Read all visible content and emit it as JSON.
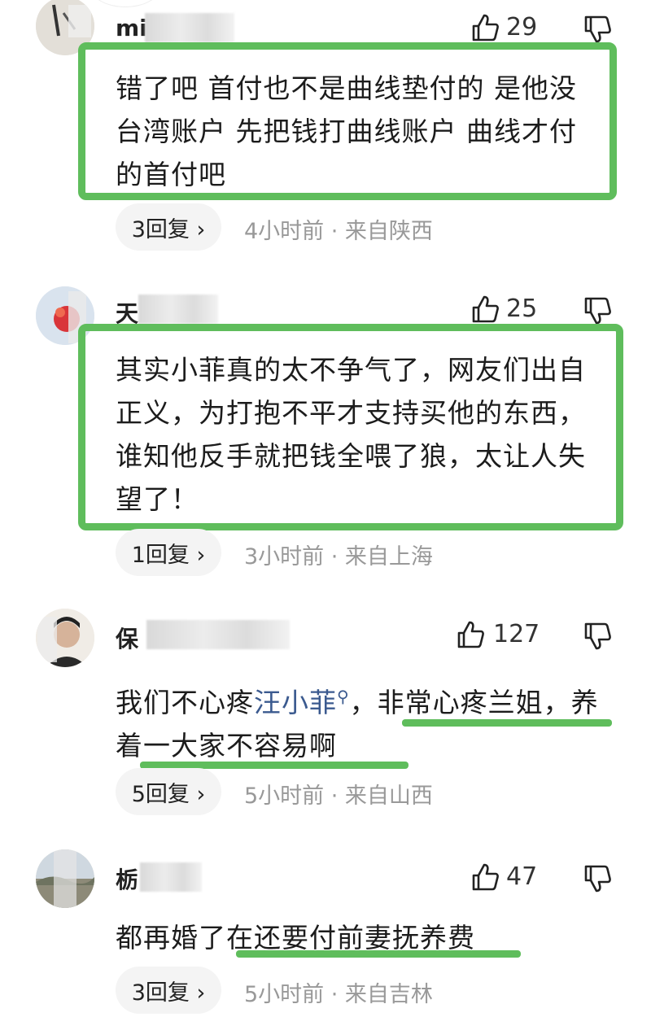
{
  "colors": {
    "highlight_green": "#5fbd5c",
    "link_blue": "#3b5a8f",
    "meta_gray": "#999999"
  },
  "comments": [
    {
      "username": "mi",
      "likes": "29",
      "text": "错了吧 首付也不是曲线垫付的 是他没台湾账户 先把钱打曲线账户 曲线才付的首付吧",
      "replies": "3回复 ›",
      "meta": "4小时前 · 来自陕西"
    },
    {
      "username": "天",
      "likes": "25",
      "text": "其实小菲真的太不争气了，网友们出自正义，为打抱不平才支持买他的东西，谁知他反手就把钱全喂了狼，太让人失望了！",
      "replies": "1回复 ›",
      "meta": "3小时前 · 来自上海"
    },
    {
      "username": "保",
      "likes": "127",
      "text_before": "我们不心疼",
      "text_link": "汪小菲",
      "text_after": "，非常心疼兰姐，养着一大家不容易啊",
      "replies": "5回复 ›",
      "meta": "5小时前 · 来自山西"
    },
    {
      "username": "栃",
      "likes": "47",
      "text": "都再婚了在还要付前妻抚养费",
      "replies": "3回复 ›",
      "meta": "5小时前 · 来自吉林"
    }
  ],
  "icons": {
    "like": "thumbs-up-icon",
    "dislike": "thumbs-down-icon",
    "search": "search-icon"
  }
}
